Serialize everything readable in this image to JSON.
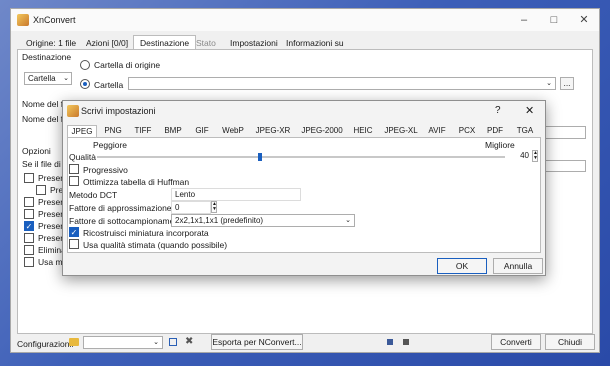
{
  "window": {
    "title": "XnConvert"
  },
  "tabs": [
    "Origine: 1 file",
    "Azioni [0/0]",
    "Destinazione",
    "Stato",
    "Impostazioni",
    "Informazioni su"
  ],
  "destination": {
    "section_label": "Destinazione",
    "folder_combo": "Cartella",
    "radio_origin": "Cartella di origine",
    "radio_folder": "Cartella",
    "browse": "...",
    "name_label_1": "Nome del fi",
    "name_label_2": "Nome del fi",
    "options_label": "Opzioni",
    "if_file_label": "Se il file di",
    "opt_items": [
      "Preserv",
      "Pres",
      "Preserv",
      "Preserv",
      "Preserv",
      "Preserv",
      "Elimina",
      "Usa mo"
    ]
  },
  "footer": {
    "config_label": "Configurazioni:",
    "export_btn": "Esporta per NConvert...",
    "convert_btn": "Converti",
    "close_btn": "Chiudi"
  },
  "dialog": {
    "title": "Scrivi impostazioni",
    "help": "?",
    "close": "✕",
    "formats": [
      "JPEG",
      "PNG",
      "TIFF",
      "BMP",
      "GIF",
      "WebP",
      "JPEG-XR",
      "JPEG-2000",
      "HEIC",
      "JPEG-XL",
      "AVIF",
      "PCX",
      "PDF",
      "TGA"
    ],
    "worst_label": "Peggiore",
    "best_label": "Migliore",
    "quality_label": "Qualità",
    "quality_value": "40",
    "quality_fraction": 0.4,
    "progressive": "Progressivo",
    "huffman": "Ottimizza tabella di Huffman",
    "dct_label": "Metodo DCT",
    "dct_value": "Lento",
    "smoothing_label": "Fattore di approssimazione",
    "smoothing_value": "0",
    "subsampling_label": "Fattore di sottocampionamento",
    "subsampling_value": "2x2,1x1,1x1 (predefinito)",
    "rebuild_thumb": "Ricostruisci miniatura incorporata",
    "estimated_quality": "Usa qualità stimata (quando possibile)",
    "ok": "OK",
    "cancel": "Annulla"
  }
}
